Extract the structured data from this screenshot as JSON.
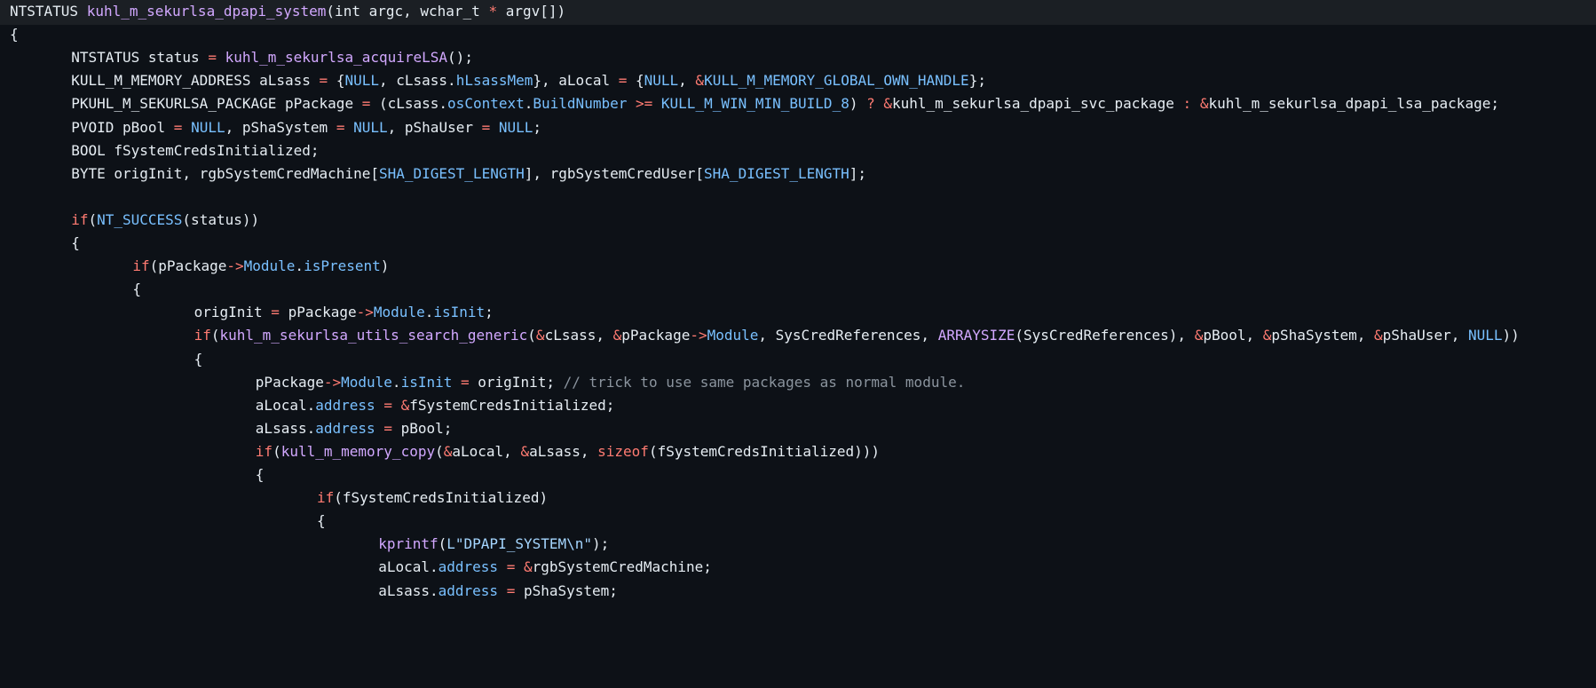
{
  "code": {
    "lines": [
      {
        "indent": "",
        "active": true,
        "tokens": [
          {
            "t": "NTSTATUS ",
            "c": "plain"
          },
          {
            "t": "kuhl_m_sekurlsa_dpapi_system",
            "c": "func"
          },
          {
            "t": "(int argc, wchar_t ",
            "c": "plain"
          },
          {
            "t": "*",
            "c": "op"
          },
          {
            "t": " argv[])",
            "c": "plain"
          }
        ]
      },
      {
        "indent": "",
        "tokens": [
          {
            "t": "{",
            "c": "plain"
          }
        ]
      },
      {
        "indent": "\t",
        "tokens": [
          {
            "t": "NTSTATUS status ",
            "c": "plain"
          },
          {
            "t": "=",
            "c": "op"
          },
          {
            "t": " ",
            "c": "plain"
          },
          {
            "t": "kuhl_m_sekurlsa_acquireLSA",
            "c": "func"
          },
          {
            "t": "();",
            "c": "plain"
          }
        ]
      },
      {
        "indent": "\t",
        "tokens": [
          {
            "t": "KULL_M_MEMORY_ADDRESS aLsass ",
            "c": "plain"
          },
          {
            "t": "=",
            "c": "op"
          },
          {
            "t": " {",
            "c": "plain"
          },
          {
            "t": "NULL",
            "c": "const"
          },
          {
            "t": ", cLsass.",
            "c": "plain"
          },
          {
            "t": "hLsassMem",
            "c": "member"
          },
          {
            "t": "}, aLocal ",
            "c": "plain"
          },
          {
            "t": "=",
            "c": "op"
          },
          {
            "t": " {",
            "c": "plain"
          },
          {
            "t": "NULL",
            "c": "const"
          },
          {
            "t": ", ",
            "c": "plain"
          },
          {
            "t": "&",
            "c": "op"
          },
          {
            "t": "KULL_M_MEMORY_GLOBAL_OWN_HANDLE",
            "c": "const"
          },
          {
            "t": "};",
            "c": "plain"
          }
        ]
      },
      {
        "indent": "\t",
        "tokens": [
          {
            "t": "PKUHL_M_SEKURLSA_PACKAGE pPackage ",
            "c": "plain"
          },
          {
            "t": "=",
            "c": "op"
          },
          {
            "t": " (cLsass.",
            "c": "plain"
          },
          {
            "t": "osContext",
            "c": "member"
          },
          {
            "t": ".",
            "c": "plain"
          },
          {
            "t": "BuildNumber",
            "c": "member"
          },
          {
            "t": " ",
            "c": "plain"
          },
          {
            "t": ">=",
            "c": "op"
          },
          {
            "t": " ",
            "c": "plain"
          },
          {
            "t": "KULL_M_WIN_MIN_BUILD_8",
            "c": "const"
          },
          {
            "t": ") ",
            "c": "plain"
          },
          {
            "t": "?",
            "c": "op"
          },
          {
            "t": " ",
            "c": "plain"
          },
          {
            "t": "&",
            "c": "op"
          },
          {
            "t": "kuhl_m_sekurlsa_dpapi_svc_package ",
            "c": "plain"
          },
          {
            "t": ":",
            "c": "op"
          },
          {
            "t": " ",
            "c": "plain"
          },
          {
            "t": "&",
            "c": "op"
          },
          {
            "t": "kuhl_m_sekurlsa_dpapi_lsa_package;",
            "c": "plain"
          }
        ]
      },
      {
        "indent": "\t",
        "tokens": [
          {
            "t": "PVOID pBool ",
            "c": "plain"
          },
          {
            "t": "=",
            "c": "op"
          },
          {
            "t": " ",
            "c": "plain"
          },
          {
            "t": "NULL",
            "c": "const"
          },
          {
            "t": ", pShaSystem ",
            "c": "plain"
          },
          {
            "t": "=",
            "c": "op"
          },
          {
            "t": " ",
            "c": "plain"
          },
          {
            "t": "NULL",
            "c": "const"
          },
          {
            "t": ", pShaUser ",
            "c": "plain"
          },
          {
            "t": "=",
            "c": "op"
          },
          {
            "t": " ",
            "c": "plain"
          },
          {
            "t": "NULL",
            "c": "const"
          },
          {
            "t": ";",
            "c": "plain"
          }
        ]
      },
      {
        "indent": "\t",
        "tokens": [
          {
            "t": "BOOL fSystemCredsInitialized;",
            "c": "plain"
          }
        ]
      },
      {
        "indent": "\t",
        "tokens": [
          {
            "t": "BYTE origInit, rgbSystemCredMachine[",
            "c": "plain"
          },
          {
            "t": "SHA_DIGEST_LENGTH",
            "c": "const"
          },
          {
            "t": "], rgbSystemCredUser[",
            "c": "plain"
          },
          {
            "t": "SHA_DIGEST_LENGTH",
            "c": "const"
          },
          {
            "t": "];",
            "c": "plain"
          }
        ]
      },
      {
        "indent": "",
        "tokens": []
      },
      {
        "indent": "\t",
        "tokens": [
          {
            "t": "if",
            "c": "kw"
          },
          {
            "t": "(",
            "c": "plain"
          },
          {
            "t": "NT_SUCCESS",
            "c": "const"
          },
          {
            "t": "(status))",
            "c": "plain"
          }
        ]
      },
      {
        "indent": "\t",
        "tokens": [
          {
            "t": "{",
            "c": "plain"
          }
        ]
      },
      {
        "indent": "\t\t",
        "tokens": [
          {
            "t": "if",
            "c": "kw"
          },
          {
            "t": "(pPackage",
            "c": "plain"
          },
          {
            "t": "->",
            "c": "op"
          },
          {
            "t": "Module",
            "c": "member"
          },
          {
            "t": ".",
            "c": "plain"
          },
          {
            "t": "isPresent",
            "c": "member"
          },
          {
            "t": ")",
            "c": "plain"
          }
        ]
      },
      {
        "indent": "\t\t",
        "tokens": [
          {
            "t": "{",
            "c": "plain"
          }
        ]
      },
      {
        "indent": "\t\t\t",
        "tokens": [
          {
            "t": "origInit ",
            "c": "plain"
          },
          {
            "t": "=",
            "c": "op"
          },
          {
            "t": " pPackage",
            "c": "plain"
          },
          {
            "t": "->",
            "c": "op"
          },
          {
            "t": "Module",
            "c": "member"
          },
          {
            "t": ".",
            "c": "plain"
          },
          {
            "t": "isInit",
            "c": "member"
          },
          {
            "t": ";",
            "c": "plain"
          }
        ]
      },
      {
        "indent": "\t\t\t",
        "tokens": [
          {
            "t": "if",
            "c": "kw"
          },
          {
            "t": "(",
            "c": "plain"
          },
          {
            "t": "kuhl_m_sekurlsa_utils_search_generic",
            "c": "func"
          },
          {
            "t": "(",
            "c": "plain"
          },
          {
            "t": "&",
            "c": "op"
          },
          {
            "t": "cLsass, ",
            "c": "plain"
          },
          {
            "t": "&",
            "c": "op"
          },
          {
            "t": "pPackage",
            "c": "plain"
          },
          {
            "t": "->",
            "c": "op"
          },
          {
            "t": "Module",
            "c": "member"
          },
          {
            "t": ", SysCredReferences, ",
            "c": "plain"
          },
          {
            "t": "ARRAYSIZE",
            "c": "func"
          },
          {
            "t": "(SysCredReferences), ",
            "c": "plain"
          },
          {
            "t": "&",
            "c": "op"
          },
          {
            "t": "pBool, ",
            "c": "plain"
          },
          {
            "t": "&",
            "c": "op"
          },
          {
            "t": "pShaSystem, ",
            "c": "plain"
          },
          {
            "t": "&",
            "c": "op"
          },
          {
            "t": "pShaUser, ",
            "c": "plain"
          },
          {
            "t": "NULL",
            "c": "const"
          },
          {
            "t": "))",
            "c": "plain"
          }
        ]
      },
      {
        "indent": "\t\t\t",
        "tokens": [
          {
            "t": "{",
            "c": "plain"
          }
        ]
      },
      {
        "indent": "\t\t\t\t",
        "tokens": [
          {
            "t": "pPackage",
            "c": "plain"
          },
          {
            "t": "->",
            "c": "op"
          },
          {
            "t": "Module",
            "c": "member"
          },
          {
            "t": ".",
            "c": "plain"
          },
          {
            "t": "isInit",
            "c": "member"
          },
          {
            "t": " ",
            "c": "plain"
          },
          {
            "t": "=",
            "c": "op"
          },
          {
            "t": " origInit; ",
            "c": "plain"
          },
          {
            "t": "// trick to use same packages as normal module.",
            "c": "comment"
          }
        ]
      },
      {
        "indent": "\t\t\t\t",
        "tokens": [
          {
            "t": "aLocal.",
            "c": "plain"
          },
          {
            "t": "address",
            "c": "member"
          },
          {
            "t": " ",
            "c": "plain"
          },
          {
            "t": "=",
            "c": "op"
          },
          {
            "t": " ",
            "c": "plain"
          },
          {
            "t": "&",
            "c": "op"
          },
          {
            "t": "fSystemCredsInitialized;",
            "c": "plain"
          }
        ]
      },
      {
        "indent": "\t\t\t\t",
        "tokens": [
          {
            "t": "aLsass.",
            "c": "plain"
          },
          {
            "t": "address",
            "c": "member"
          },
          {
            "t": " ",
            "c": "plain"
          },
          {
            "t": "=",
            "c": "op"
          },
          {
            "t": " pBool;",
            "c": "plain"
          }
        ]
      },
      {
        "indent": "\t\t\t\t",
        "tokens": [
          {
            "t": "if",
            "c": "kw"
          },
          {
            "t": "(",
            "c": "plain"
          },
          {
            "t": "kull_m_memory_copy",
            "c": "func"
          },
          {
            "t": "(",
            "c": "plain"
          },
          {
            "t": "&",
            "c": "op"
          },
          {
            "t": "aLocal, ",
            "c": "plain"
          },
          {
            "t": "&",
            "c": "op"
          },
          {
            "t": "aLsass, ",
            "c": "plain"
          },
          {
            "t": "sizeof",
            "c": "kw"
          },
          {
            "t": "(fSystemCredsInitialized)))",
            "c": "plain"
          }
        ]
      },
      {
        "indent": "\t\t\t\t",
        "tokens": [
          {
            "t": "{",
            "c": "plain"
          }
        ]
      },
      {
        "indent": "\t\t\t\t\t",
        "tokens": [
          {
            "t": "if",
            "c": "kw"
          },
          {
            "t": "(fSystemCredsInitialized)",
            "c": "plain"
          }
        ]
      },
      {
        "indent": "\t\t\t\t\t",
        "tokens": [
          {
            "t": "{",
            "c": "plain"
          }
        ]
      },
      {
        "indent": "\t\t\t\t\t\t",
        "tokens": [
          {
            "t": "kprintf",
            "c": "func"
          },
          {
            "t": "(",
            "c": "plain"
          },
          {
            "t": "L\"DPAPI_SYSTEM\\n\"",
            "c": "str"
          },
          {
            "t": ");",
            "c": "plain"
          }
        ]
      },
      {
        "indent": "\t\t\t\t\t\t",
        "tokens": [
          {
            "t": "aLocal.",
            "c": "plain"
          },
          {
            "t": "address",
            "c": "member"
          },
          {
            "t": " ",
            "c": "plain"
          },
          {
            "t": "=",
            "c": "op"
          },
          {
            "t": " ",
            "c": "plain"
          },
          {
            "t": "&",
            "c": "op"
          },
          {
            "t": "rgbSystemCredMachine;",
            "c": "plain"
          }
        ]
      },
      {
        "indent": "\t\t\t\t\t\t",
        "tokens": [
          {
            "t": "aLsass.",
            "c": "plain"
          },
          {
            "t": "address",
            "c": "member"
          },
          {
            "t": " ",
            "c": "plain"
          },
          {
            "t": "=",
            "c": "op"
          },
          {
            "t": " pShaSystem;",
            "c": "plain"
          }
        ]
      }
    ]
  },
  "colors": {
    "background": "#0d1117",
    "active_line": "#1b1f24",
    "text": "#e6edf3",
    "function": "#d2a8ff",
    "keyword": "#ff7b72",
    "constant": "#79c0ff",
    "comment": "#8b949e"
  }
}
